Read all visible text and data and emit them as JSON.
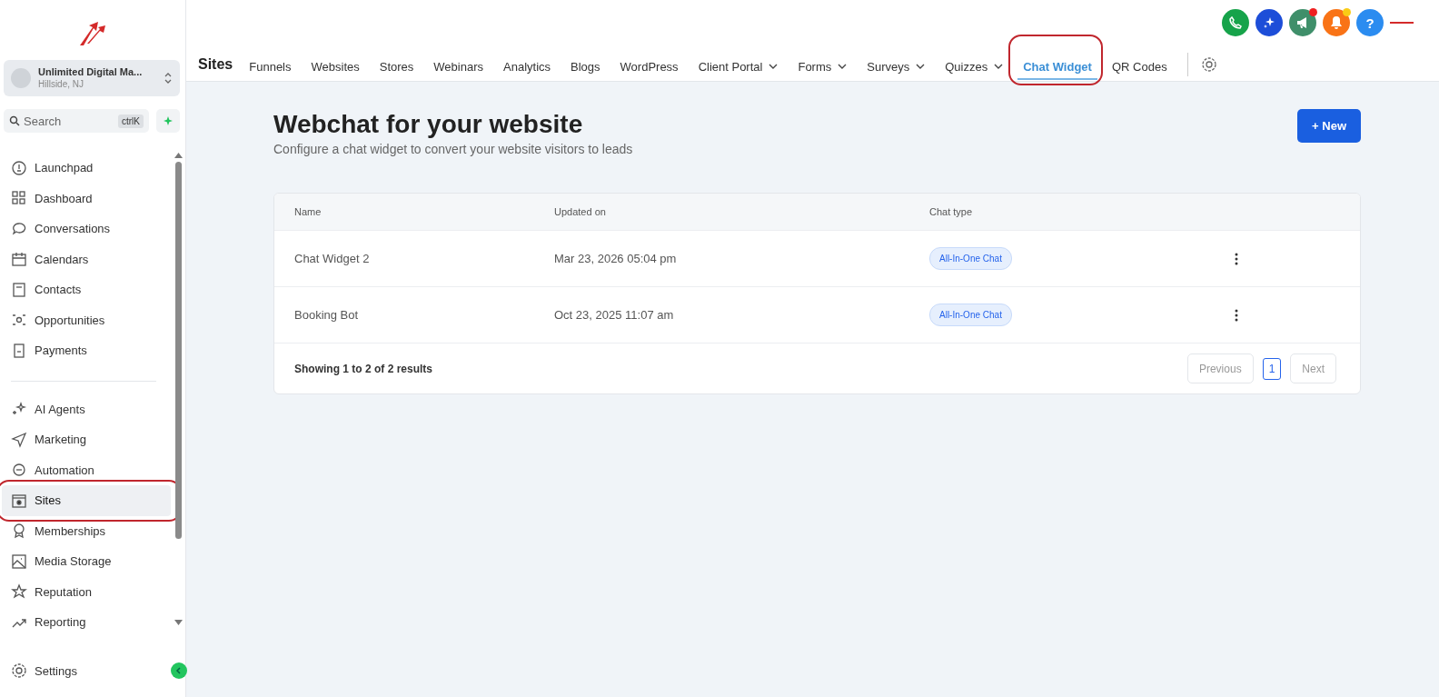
{
  "sidebar": {
    "account": {
      "name": "Unlimited Digital Ma...",
      "location": "Hillside, NJ"
    },
    "search": {
      "placeholder": "Search",
      "shortcut": "ctrlK"
    },
    "nav_groups": [
      [
        {
          "label": "Launchpad",
          "selected": false,
          "circled": false
        },
        {
          "label": "Dashboard",
          "selected": false,
          "circled": false
        },
        {
          "label": "Conversations",
          "selected": false,
          "circled": false
        },
        {
          "label": "Calendars",
          "selected": false,
          "circled": false
        },
        {
          "label": "Contacts",
          "selected": false,
          "circled": false
        },
        {
          "label": "Opportunities",
          "selected": false,
          "circled": false
        },
        {
          "label": "Payments",
          "selected": false,
          "circled": false
        }
      ],
      [
        {
          "label": "AI Agents",
          "selected": false,
          "circled": false
        },
        {
          "label": "Marketing",
          "selected": false,
          "circled": false
        },
        {
          "label": "Automation",
          "selected": false,
          "circled": false
        },
        {
          "label": "Sites",
          "selected": true,
          "circled": true
        },
        {
          "label": "Memberships",
          "selected": false,
          "circled": false
        },
        {
          "label": "Media Storage",
          "selected": false,
          "circled": false
        },
        {
          "label": "Reputation",
          "selected": false,
          "circled": false
        },
        {
          "label": "Reporting",
          "selected": false,
          "circled": false
        }
      ]
    ],
    "settings": "Settings"
  },
  "topbar": {
    "title": "Sites",
    "tabs": [
      {
        "label": "Funnels",
        "selected": false,
        "dropdown": false,
        "circled": false
      },
      {
        "label": "Websites",
        "selected": false,
        "dropdown": false,
        "circled": false
      },
      {
        "label": "Stores",
        "selected": false,
        "dropdown": false,
        "circled": false
      },
      {
        "label": "Webinars",
        "selected": false,
        "dropdown": false,
        "circled": false
      },
      {
        "label": "Analytics",
        "selected": false,
        "dropdown": false,
        "circled": false
      },
      {
        "label": "Blogs",
        "selected": false,
        "dropdown": false,
        "circled": false
      },
      {
        "label": "WordPress",
        "selected": false,
        "dropdown": false,
        "circled": false
      },
      {
        "label": "Client Portal",
        "selected": false,
        "dropdown": true,
        "circled": false
      },
      {
        "label": "Forms",
        "selected": false,
        "dropdown": true,
        "circled": false
      },
      {
        "label": "Surveys",
        "selected": false,
        "dropdown": true,
        "circled": false
      },
      {
        "label": "Quizzes",
        "selected": false,
        "dropdown": true,
        "circled": false
      },
      {
        "label": "Chat Widget",
        "selected": true,
        "dropdown": false,
        "circled": true
      },
      {
        "label": "QR Codes",
        "selected": false,
        "dropdown": false,
        "circled": false
      }
    ],
    "help": "?"
  },
  "page": {
    "title": "Webchat for your website",
    "subtitle": "Configure a chat widget to convert your website visitors to leads",
    "new_button": "+ New"
  },
  "table": {
    "columns": [
      "Name",
      "Updated on",
      "Chat type"
    ],
    "rows": [
      {
        "name": "Chat Widget 2",
        "updated": "Mar 23, 2026 05:04 pm",
        "chat_type": "All-In-One Chat"
      },
      {
        "name": "Booking Bot",
        "updated": "Oct 23, 2025 11:07 am",
        "chat_type": "All-In-One Chat"
      }
    ],
    "summary": "Showing 1 to 2 of 2 results",
    "pagination": {
      "previous": "Previous",
      "pages": [
        {
          "label": "1",
          "selected": true
        }
      ],
      "next": "Next"
    }
  }
}
